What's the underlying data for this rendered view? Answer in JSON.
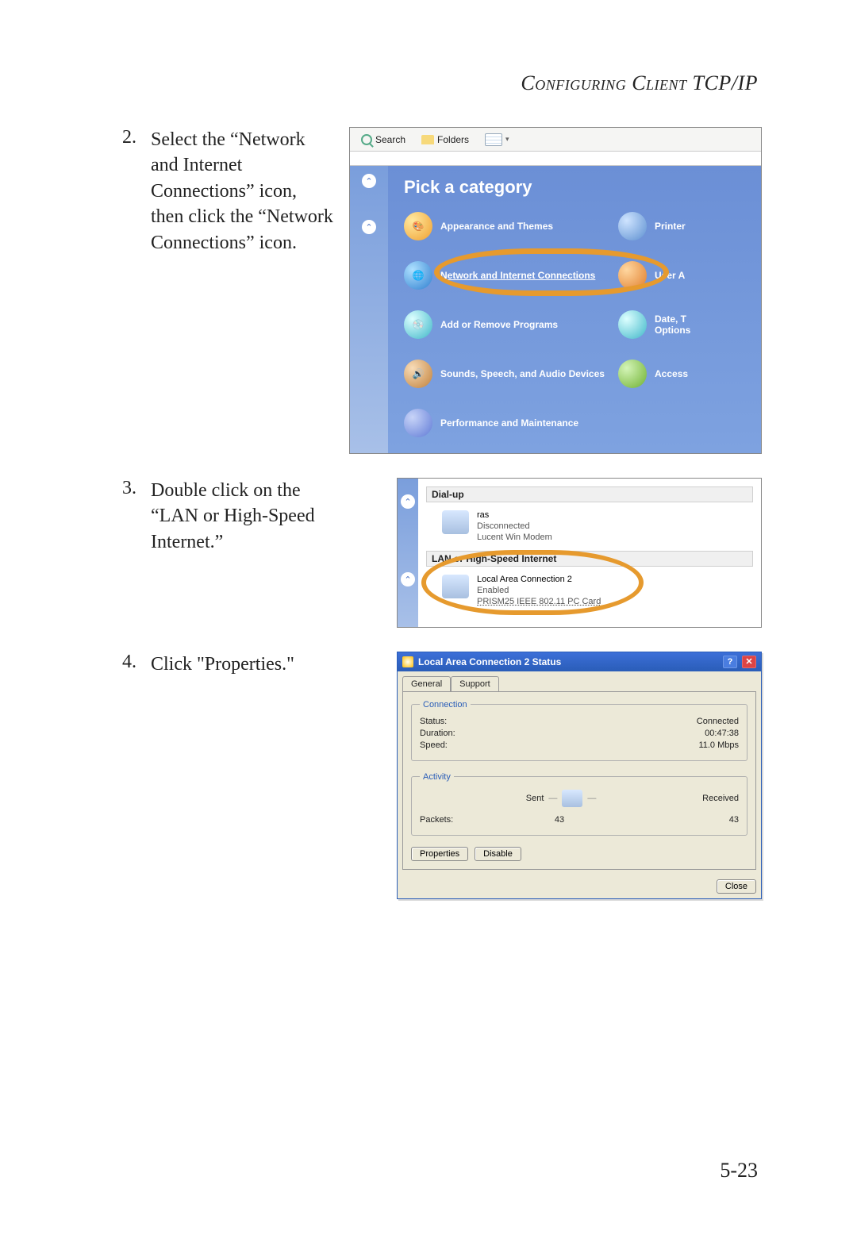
{
  "header": "Configuring Client TCP/IP",
  "page_number": "5-23",
  "steps": [
    {
      "num": "2.",
      "text": "Select the “Network and Internet Connections” icon, then click the “Network Connections” icon."
    },
    {
      "num": "3.",
      "text": "Double click on the “LAN or High-Speed Internet.”"
    },
    {
      "num": "4.",
      "text": "Click \"Properties.\""
    }
  ],
  "fig1": {
    "toolbar": {
      "search": "Search",
      "folders": "Folders"
    },
    "title": "Pick a category",
    "cats_left": [
      "Appearance and Themes",
      "Network and Internet Connections",
      "Add or Remove Programs",
      "Sounds, Speech, and Audio Devices",
      "Performance and Maintenance"
    ],
    "cats_right": [
      "Printer",
      "User A",
      "Date, T\nOptions",
      "Access"
    ]
  },
  "fig2": {
    "hdr_dialup": "Dial-up",
    "dialup": {
      "name": "ras",
      "status": "Disconnected",
      "device": "Lucent Win Modem"
    },
    "hdr_lan": "LAN or High-Speed Internet",
    "lan": {
      "name": "Local Area Connection 2",
      "status": "Enabled",
      "device": "PRISM25 IEEE 802.11 PC Card"
    }
  },
  "fig3": {
    "title": "Local Area Connection 2 Status",
    "tabs": {
      "general": "General",
      "support": "Support"
    },
    "conn": {
      "legend": "Connection",
      "status_l": "Status:",
      "status_v": "Connected",
      "dur_l": "Duration:",
      "dur_v": "00:47:38",
      "speed_l": "Speed:",
      "speed_v": "11.0 Mbps"
    },
    "act": {
      "legend": "Activity",
      "sent": "Sent",
      "recv": "Received",
      "packets_l": "Packets:",
      "sent_v": "43",
      "recv_v": "43"
    },
    "btn_props": "Properties",
    "btn_disable": "Disable",
    "btn_close": "Close"
  }
}
